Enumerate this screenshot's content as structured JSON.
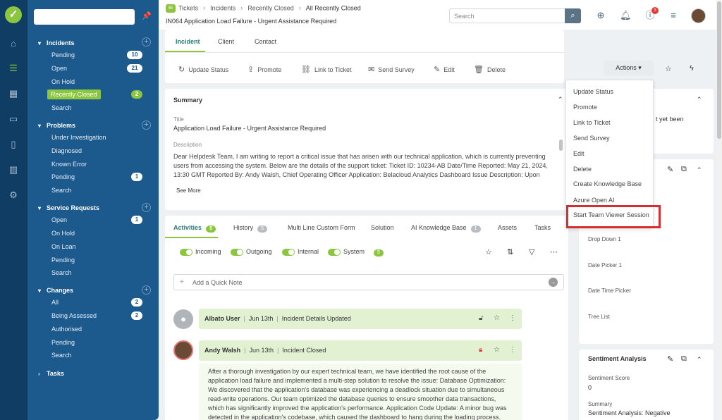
{
  "sidebar": {
    "sections": [
      {
        "title": "Incidents",
        "items": [
          {
            "label": "Pending",
            "badge": "10"
          },
          {
            "label": "Open",
            "badge": "21"
          },
          {
            "label": "On Hold"
          },
          {
            "label": "Recently Closed",
            "badge": "2",
            "selected": true
          },
          {
            "label": "Search"
          }
        ]
      },
      {
        "title": "Problems",
        "items": [
          {
            "label": "Under Investigation"
          },
          {
            "label": "Diagnosed"
          },
          {
            "label": "Known Error"
          },
          {
            "label": "Pending",
            "badge": "1"
          },
          {
            "label": "Search"
          }
        ]
      },
      {
        "title": "Service Requests",
        "items": [
          {
            "label": "Open",
            "badge": "1"
          },
          {
            "label": "On Hold"
          },
          {
            "label": "On Loan"
          },
          {
            "label": "Pending"
          },
          {
            "label": "Search"
          }
        ]
      },
      {
        "title": "Changes",
        "items": [
          {
            "label": "All",
            "badge": "2"
          },
          {
            "label": "Being Assessed",
            "badge": "2"
          },
          {
            "label": "Authorised"
          },
          {
            "label": "Pending"
          },
          {
            "label": "Search"
          }
        ]
      },
      {
        "title": "Tasks",
        "items": []
      }
    ]
  },
  "topbar": {
    "breadcrumb": [
      "Tickets",
      "Incidents",
      "Recently Closed",
      "All Recently Closed"
    ],
    "ticket_icon": "BI",
    "subtitle": "IN064 Application Load Failure - Urgent Assistance Required",
    "search_placeholder": "Search",
    "notif_count": "3"
  },
  "tabs": [
    "Incident",
    "Client",
    "Contact"
  ],
  "toolbar": {
    "update_status": "Update Status",
    "promote": "Promote",
    "link": "Link to Ticket",
    "survey": "Send Survey",
    "edit": "Edit",
    "delete": "Delete",
    "actions": "Actions ▾"
  },
  "summary": {
    "heading": "Summary",
    "title_label": "Title",
    "title_value": "Application Load Failure - Urgent Assistance Required",
    "desc_label": "Description",
    "desc_value": "Dear Helpdesk Team, I am writing to report a critical issue that has arisen with our technical application, which is currently preventing users from accessing the system. Below are the details of the support ticket: Ticket ID: 10234-AB Date/Time Reported: May 21, 2024, 13:30 GMT Reported By: Andy Walsh, Chief Operating Officer Application: Belacloud Analytics Dashboard Issue Description: Upon attempting to log in",
    "see_more": "See More"
  },
  "activity_tabs": [
    {
      "label": "Activities",
      "count": "5"
    },
    {
      "label": "History",
      "count": "5"
    },
    {
      "label": "Multi Line Custom Form"
    },
    {
      "label": "Solution"
    },
    {
      "label": "AI Knowledge Base",
      "count": "1"
    },
    {
      "label": "Assets"
    },
    {
      "label": "Tasks"
    }
  ],
  "filters": {
    "incoming": "Incoming",
    "outgoing": "Outgoing",
    "internal": "Internal",
    "system": "System",
    "count": "5"
  },
  "quick_note": "Add a Quick Note",
  "feed": [
    {
      "user": "Albato User",
      "date": "Jun 13th",
      "event": "Incident Details Updated"
    },
    {
      "user": "Andy Walsh",
      "date": "Jun 13th",
      "event": "Incident Closed",
      "body": "After a thorough investigation by our expert technical team, we have identified the root cause of the application load failure and implemented a multi-step solution to resolve the issue: Database Optimization: We discovered that the application's database was experiencing a deadlock situation due to simultaneous read-write operations. Our team optimized the database queries to ensure smoother data transactions, which has significantly improved the application's performance. Application Code Update: A minor bug was detected in the application's codebase, which caused the dashboard to hang during the loading process. The development team has deployed"
    }
  ],
  "dropdown": [
    "Update Status",
    "Promote",
    "Link to Ticket",
    "Send Survey",
    "Edit",
    "Delete",
    "Create Knowledge Base",
    "Azure Open AI",
    "Start Team Viewer Session"
  ],
  "right": {
    "partial_text": "t yet been",
    "fields": [
      "Drop Down 1",
      "Date Picker 1",
      "Date Time Picker",
      "Tree List"
    ],
    "sentiment_heading": "Sentiment Analysis",
    "score_label": "Sentiment Score",
    "score_value": "0",
    "summary_label": "Summary",
    "summary_value": "Sentiment Analysis: Negative"
  }
}
